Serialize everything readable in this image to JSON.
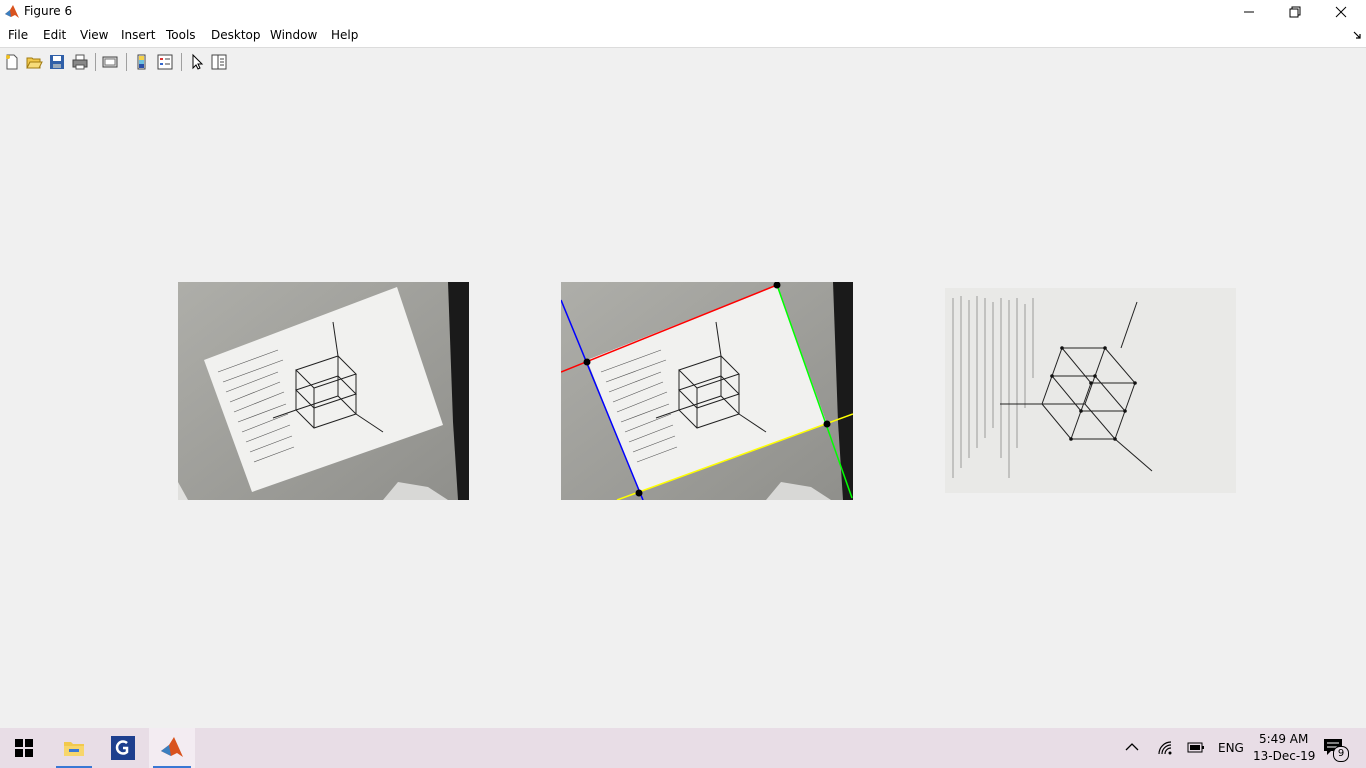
{
  "window": {
    "title": "Figure 6"
  },
  "menu": {
    "items": [
      "File",
      "Edit",
      "View",
      "Insert",
      "Tools",
      "Desktop",
      "Window",
      "Help"
    ]
  },
  "toolbar": {
    "buttons": [
      "new-figure",
      "open-file",
      "save-figure",
      "print-figure",
      "link-plot",
      "insert-colorbar",
      "insert-legend",
      "edit-plot",
      "open-property-inspector"
    ]
  },
  "figure": {
    "panels": [
      "original-photo",
      "detected-corners",
      "rectified-page"
    ],
    "line_colors": {
      "top": "#ff0000",
      "right": "#00ff00",
      "bottom": "#ffff00",
      "left": "#0000ff"
    }
  },
  "taskbar": {
    "apps": [
      "start",
      "file-explorer",
      "pdf-app",
      "matlab"
    ],
    "tray": {
      "language": "ENG",
      "time": "5:49 AM",
      "date": "13-Dec-19",
      "notifications": "9"
    }
  }
}
